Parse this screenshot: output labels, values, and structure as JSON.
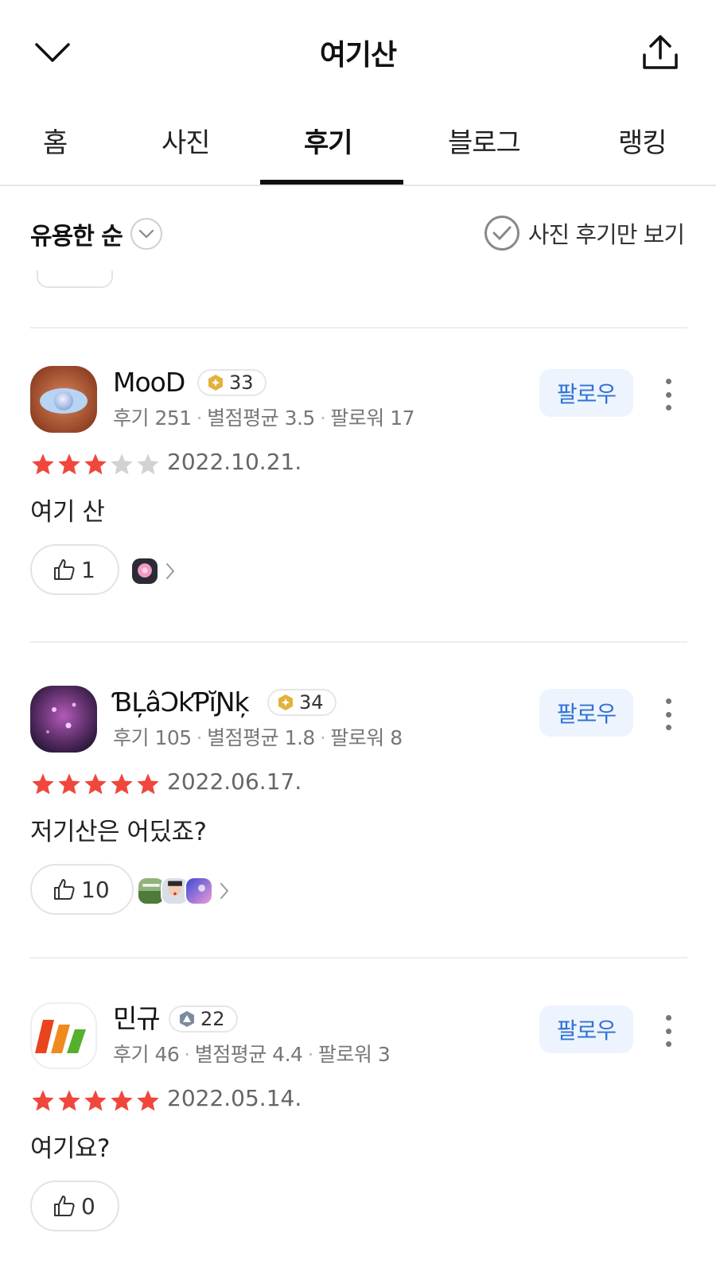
{
  "header": {
    "title": "여기산"
  },
  "tabs": [
    {
      "label": "홈",
      "active": false
    },
    {
      "label": "사진",
      "active": false
    },
    {
      "label": "후기",
      "active": true
    },
    {
      "label": "블로그",
      "active": false
    },
    {
      "label": "랭킹",
      "active": false
    }
  ],
  "filter": {
    "sort_label": "유용한 순",
    "photo_only_label": "사진 후기만 보기"
  },
  "labels": {
    "follow": "팔로우"
  },
  "reviews": [
    {
      "user": {
        "name": "MooD",
        "level": "33",
        "review_count": "후기 251",
        "avg_rating": "별점평균 3.5",
        "followers": "팔로워 17"
      },
      "rating": 3,
      "date": "2022.10.21.",
      "text": "여기 산",
      "likes": "1",
      "liker_count": 1
    },
    {
      "user": {
        "name": "ƁĻâƆkƤĭƝķ",
        "level": "34",
        "review_count": "후기 105",
        "avg_rating": "별점평균 1.8",
        "followers": "팔로워 8"
      },
      "rating": 5,
      "date": "2022.06.17.",
      "text": "저기산은 어딨죠?",
      "likes": "10",
      "liker_count": 3
    },
    {
      "user": {
        "name": "민규",
        "level": "22",
        "review_count": "후기 46",
        "avg_rating": "별점평균 4.4",
        "followers": "팔로워 3"
      },
      "rating": 5,
      "date": "2022.05.14.",
      "text": "여기요?",
      "likes": "0",
      "liker_count": 0
    }
  ],
  "colors": {
    "star_on": "#f0463c",
    "star_off": "#d2d2d2",
    "follow_text": "#2f73d6",
    "follow_bg": "#eef4fd",
    "badge_gold": "#e2b23a",
    "badge_gray": "#7d8ba0"
  },
  "icons": {
    "back": "chevron-down-icon",
    "share": "share-upload-icon",
    "sort": "chevron-down-icon",
    "photo_only": "check-circle-icon",
    "like": "thumbs-up-icon",
    "more": "more-vertical-icon"
  }
}
